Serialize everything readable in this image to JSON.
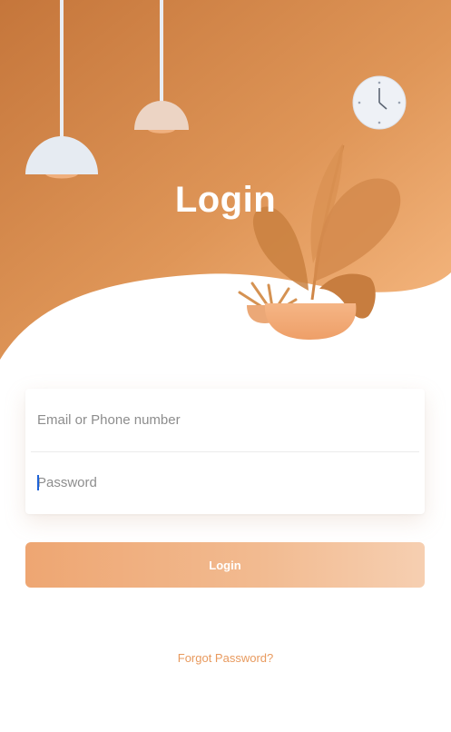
{
  "header": {
    "title": "Login"
  },
  "form": {
    "email_placeholder": "Email or Phone number",
    "email_value": "",
    "password_placeholder": "Password",
    "password_value": ""
  },
  "actions": {
    "login_label": "Login",
    "forgot_label": "Forgot Password?"
  },
  "colors": {
    "hero_gradient_start": "#c7783d",
    "hero_gradient_end": "#f6b37a",
    "button_gradient_start": "#eea672",
    "button_gradient_end": "#f6cfb1",
    "link": "#e89a5e",
    "focus_cursor": "#1e63d8"
  },
  "illustration": {
    "icons": [
      "pendant-lamp-icon",
      "wall-clock-icon",
      "potted-plant-icon"
    ]
  }
}
